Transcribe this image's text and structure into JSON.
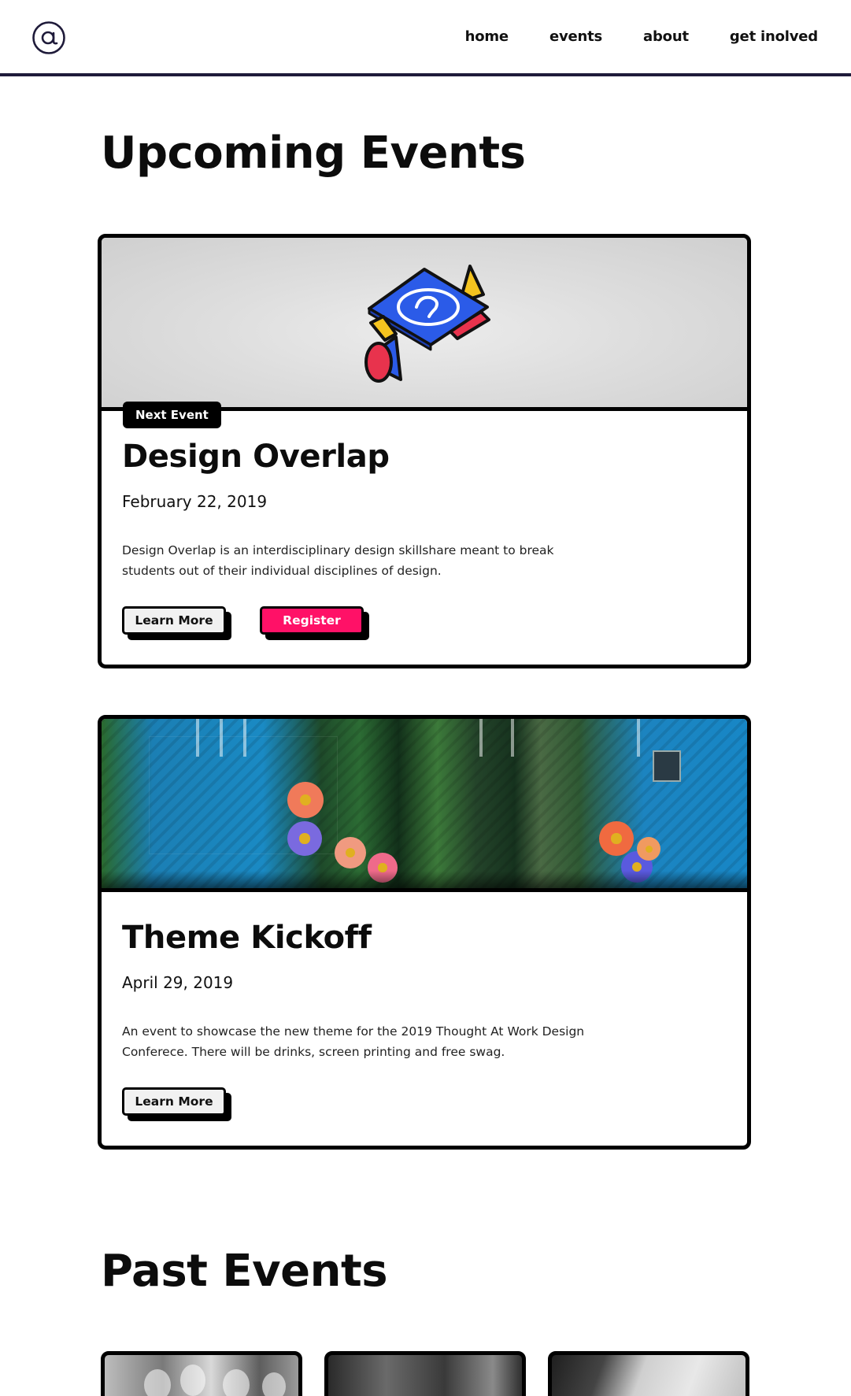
{
  "header": {
    "logo_alt": "@",
    "nav": [
      {
        "label": "home"
      },
      {
        "label": "events"
      },
      {
        "label": "about"
      },
      {
        "label": "get inolved"
      }
    ]
  },
  "upcoming": {
    "title": "Upcoming Events",
    "events": [
      {
        "badge": "Next Event",
        "title": "Design Overlap",
        "date": "February 22, 2019",
        "description": "Design Overlap is an interdisciplinary design skillshare meant to break students out of their individual disciplines of design.",
        "learn_more_label": "Learn More",
        "register_label": "Register",
        "image_icon": "isometric-tablet-illustration"
      },
      {
        "title": "Theme Kickoff",
        "date": "April 29, 2019",
        "description": "An event to showcase the new theme for the 2019 Thought At Work Design Conferece. There will be drinks, screen printing and free swag.",
        "learn_more_label": "Learn More",
        "image_icon": "festival-stage-photo"
      }
    ]
  },
  "past": {
    "title": "Past Events"
  },
  "colors": {
    "accent": "#ff1167",
    "dark": "#1f1b3a",
    "black": "#000000",
    "illustration_blue": "#2b5be8",
    "illustration_yellow": "#f5c41f",
    "illustration_red": "#e8334d"
  }
}
